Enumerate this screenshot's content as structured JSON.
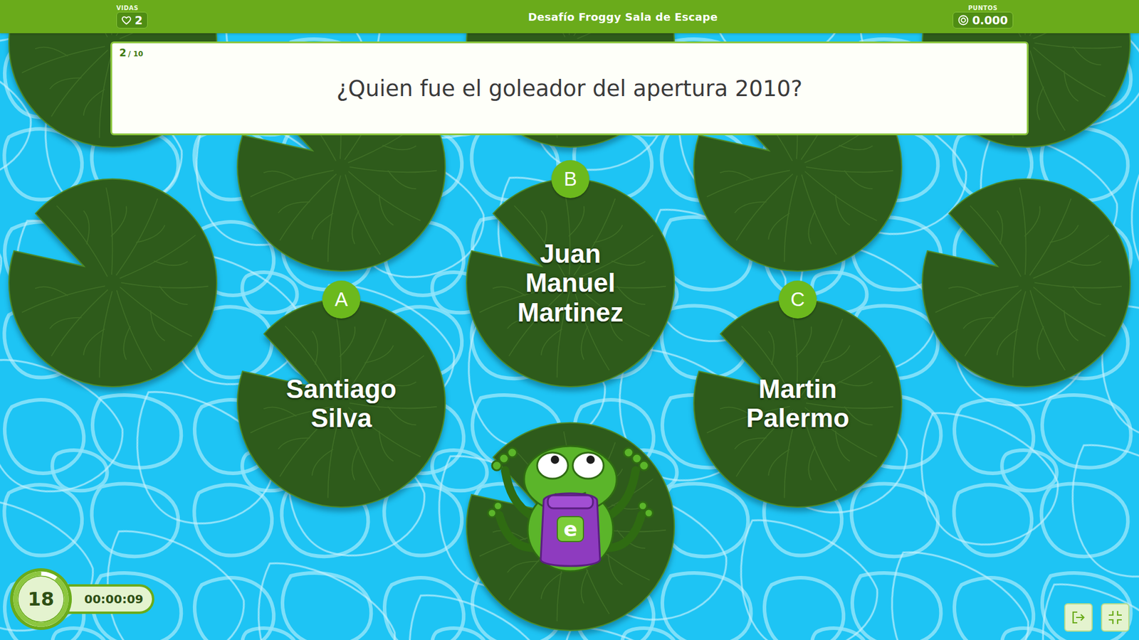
{
  "header": {
    "title": "Desafío Froggy Sala de Escape",
    "lives": {
      "label": "VIDAS",
      "value": "2"
    },
    "score": {
      "label": "PUNTOS",
      "value": "0.000"
    }
  },
  "question": {
    "current": "2",
    "total": "/ 10",
    "text": "¿Quien fue el goleador del apertura 2010?"
  },
  "answers": [
    {
      "letter": "A",
      "text": "Santiago Silva"
    },
    {
      "letter": "B",
      "text": "Juan Manuel Martinez"
    },
    {
      "letter": "C",
      "text": "Martin Palermo"
    }
  ],
  "frog": {
    "badge": "e"
  },
  "timer": {
    "seconds": "18",
    "level": 0.9,
    "elapsed": "00:00:09"
  }
}
